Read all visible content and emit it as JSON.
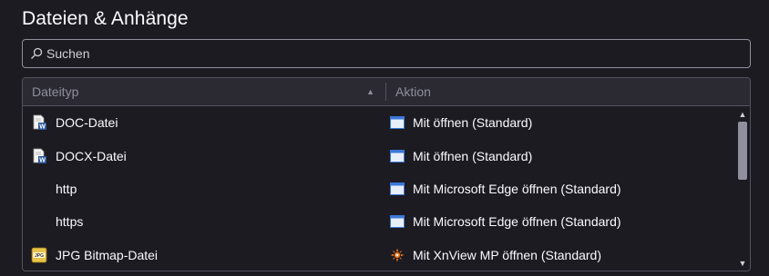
{
  "page": {
    "title": "Dateien & Anhänge"
  },
  "search": {
    "placeholder": "Suchen",
    "value": ""
  },
  "table": {
    "columns": {
      "type": "Dateityp",
      "action": "Aktion"
    },
    "sort_column": "Dateityp",
    "sort_direction": "ascending",
    "rows": [
      {
        "type": "DOC-Datei",
        "type_icon": "word-document-icon",
        "action": "Mit  öffnen (Standard)",
        "action_icon": "application-window-icon"
      },
      {
        "type": "DOCX-Datei",
        "type_icon": "word-document-icon",
        "action": "Mit  öffnen (Standard)",
        "action_icon": "application-window-icon"
      },
      {
        "type": "http",
        "type_icon": "",
        "action": "Mit Microsoft Edge öffnen (Standard)",
        "action_icon": "application-window-icon"
      },
      {
        "type": "https",
        "type_icon": "",
        "action": "Mit Microsoft Edge öffnen (Standard)",
        "action_icon": "application-window-icon"
      },
      {
        "type": "JPG Bitmap-Datei",
        "type_icon": "jpg-file-icon",
        "action": "Mit XnView MP öffnen (Standard)",
        "action_icon": "xnview-icon"
      }
    ]
  },
  "colors": {
    "background": "#1c1b22",
    "header_background": "#2b2a33",
    "border": "#52525e",
    "text": "#fbfbfe",
    "muted_text": "#8f8f9d"
  }
}
